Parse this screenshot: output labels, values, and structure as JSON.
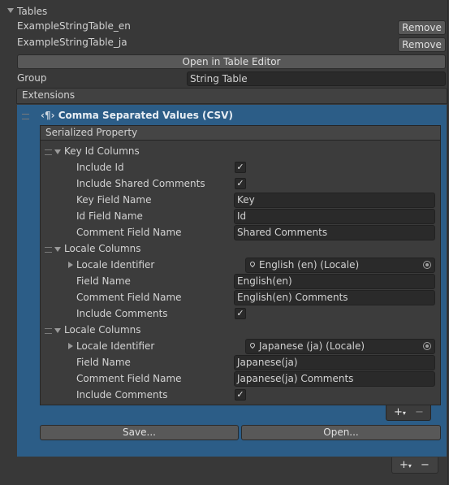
{
  "tables": {
    "header": "Tables",
    "items": [
      {
        "name": "ExampleStringTable_en",
        "remove_label": "Remove"
      },
      {
        "name": "ExampleStringTable_ja",
        "remove_label": "Remove"
      }
    ],
    "open_editor_label": "Open in Table Editor"
  },
  "group": {
    "label": "Group",
    "value": "String Table"
  },
  "extensions": {
    "header": "Extensions",
    "csv": {
      "title": "Comma Separated Values (CSV)",
      "serialized_property_label": "Serialized Property",
      "key_id_columns": {
        "label": "Key Id Columns",
        "include_id": {
          "label": "Include Id",
          "checked": true
        },
        "include_shared_comments": {
          "label": "Include Shared Comments",
          "checked": true
        },
        "key_field_name": {
          "label": "Key Field Name",
          "value": "Key"
        },
        "id_field_name": {
          "label": "Id Field Name",
          "value": "Id"
        },
        "comment_field_name": {
          "label": "Comment Field Name",
          "value": "Shared Comments"
        }
      },
      "locale_columns": [
        {
          "label": "Locale Columns",
          "locale_identifier": {
            "label": "Locale Identifier",
            "value": "English (en) (Locale)"
          },
          "field_name": {
            "label": "Field Name",
            "value": "English(en)"
          },
          "comment_field_name": {
            "label": "Comment Field Name",
            "value": "English(en) Comments"
          },
          "include_comments": {
            "label": "Include Comments",
            "checked": true
          }
        },
        {
          "label": "Locale Columns",
          "locale_identifier": {
            "label": "Locale Identifier",
            "value": "Japanese (ja) (Locale)"
          },
          "field_name": {
            "label": "Field Name",
            "value": "Japanese(ja)"
          },
          "comment_field_name": {
            "label": "Comment Field Name",
            "value": "Japanese(ja) Comments"
          },
          "include_comments": {
            "label": "Include Comments",
            "checked": true
          }
        }
      ],
      "save_label": "Save...",
      "open_label": "Open..."
    }
  },
  "list_controls": {
    "add": "+",
    "remove": "−",
    "dropdown": "▾"
  },
  "colors": {
    "selection_blue": "#2c5d87",
    "background": "#383838"
  }
}
